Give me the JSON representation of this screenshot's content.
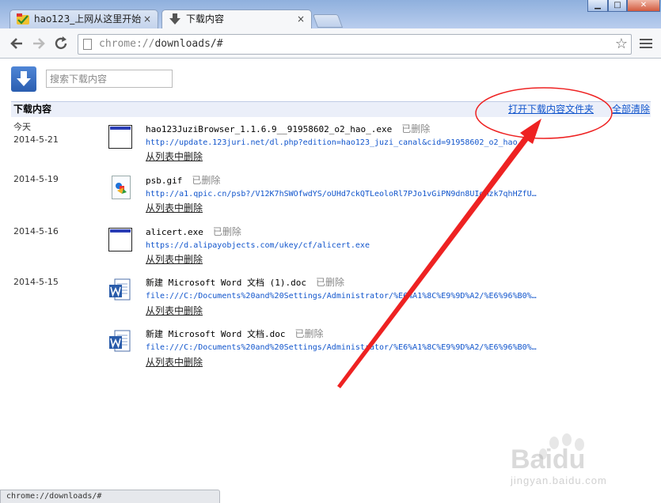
{
  "window": {
    "min": "▁",
    "max": "□",
    "close": "✕"
  },
  "tabs": [
    {
      "label": "hao123_上网从这里开始",
      "active": false
    },
    {
      "label": "下载内容",
      "active": true
    }
  ],
  "tab_close": "×",
  "address": {
    "scheme": "chrome://",
    "path": "downloads/#"
  },
  "search": {
    "placeholder": "搜索下载内容"
  },
  "header": {
    "title": "下载内容",
    "open_folder": "打开下载内容文件夹",
    "clear_all": "全部清除"
  },
  "groups": [
    {
      "date_label": "今天",
      "date": "2014-5-21",
      "items": [
        {
          "icon": "exe-icon",
          "name": "hao123JuziBrowser_1.1.6.9__91958602_o2_hao_.exe",
          "status": "已删除",
          "url": "http://update.123juri.net/dl.php?edition=hao123_juzi_canal&cid=91958602_o2_hao_",
          "remove": "从列表中删除"
        }
      ]
    },
    {
      "date_label": "",
      "date": "2014-5-19",
      "items": [
        {
          "icon": "gif-icon",
          "name": "psb.gif",
          "status": "已删除",
          "url": "http://a1.qpic.cn/psb?/V12K7hSWOfwdYS/oUHd7ckQTLeoloRl7PJo1vGiPN9dn8UIoMzk7qhHZfU…",
          "remove": "从列表中删除"
        }
      ]
    },
    {
      "date_label": "",
      "date": "2014-5-16",
      "items": [
        {
          "icon": "exe-icon",
          "name": "alicert.exe",
          "status": "已删除",
          "url": "https://d.alipayobjects.com/ukey/cf/alicert.exe",
          "remove": "从列表中删除"
        }
      ]
    },
    {
      "date_label": "",
      "date": "2014-5-15",
      "items": [
        {
          "icon": "word-doc-icon",
          "name": "新建 Microsoft Word 文档 (1).doc",
          "status": "已删除",
          "url": "file:///C:/Documents%20and%20Settings/Administrator/%E6%A1%8C%E9%9D%A2/%E6%96%B0%…",
          "remove": "从列表中删除"
        },
        {
          "icon": "word-doc-icon",
          "name": "新建 Microsoft Word 文档.doc",
          "status": "已删除",
          "url": "file:///C:/Documents%20and%20Settings/Administrator/%E6%A1%8C%E9%9D%A2/%E6%96%B0%…",
          "remove": "从列表中删除"
        }
      ]
    }
  ],
  "statusbar": "chrome://downloads/#",
  "watermark": {
    "text": "Baidu",
    "sub": "jingyan.baidu.com"
  },
  "colors": {
    "link": "#1155cc",
    "annotation": "#ee2222",
    "header_bg": "#ebeff9"
  }
}
